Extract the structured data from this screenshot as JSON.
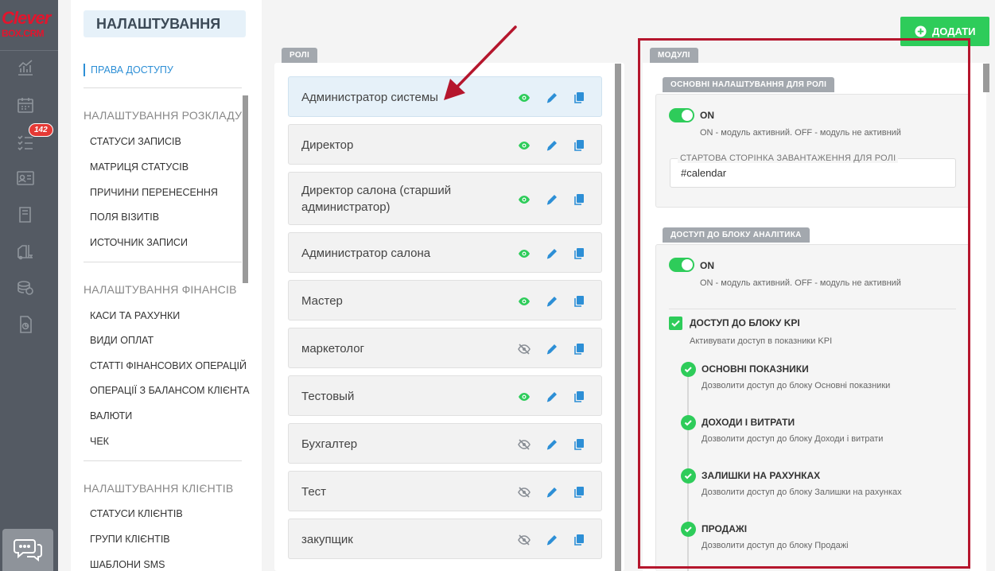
{
  "logo": {
    "line1": "Clever",
    "line2": "BOX.CRM"
  },
  "rail": {
    "badge_count": "142"
  },
  "settings": {
    "title": "НАЛАШТУВАННЯ",
    "active_item": "ПРАВА ДОСТУПУ",
    "groups": [
      {
        "heading": "НАЛАШТУВАННЯ РОЗКЛАДУ",
        "items": [
          "СТАТУСИ ЗАПИСІВ",
          "МАТРИЦЯ СТАТУСІВ",
          "ПРИЧИНИ ПЕРЕНЕСЕННЯ",
          "ПОЛЯ ВІЗИТІВ",
          "ИСТОЧНИК ЗАПИСИ"
        ]
      },
      {
        "heading": "НАЛАШТУВАННЯ ФІНАНСІВ",
        "items": [
          "КАСИ ТА РАХУНКИ",
          "ВИДИ ОПЛАТ",
          "СТАТТІ ФІНАНСОВИХ ОПЕРАЦІЙ",
          "ОПЕРАЦІЇ З БАЛАНСОМ КЛІЄНТА",
          "ВАЛЮТИ",
          "ЧЕК"
        ]
      },
      {
        "heading": "НАЛАШТУВАННЯ КЛІЄНТІВ",
        "items": [
          "СТАТУСИ КЛІЄНТІВ",
          "ГРУПИ КЛІЄНТІВ",
          "ШАБЛОНИ SMS"
        ]
      }
    ]
  },
  "roles": {
    "tab": "РОЛІ",
    "items": [
      {
        "name": "Администратор системы",
        "visible": true,
        "icon": "eye-icon"
      },
      {
        "name": "Директор",
        "visible": true,
        "icon": "eye-icon"
      },
      {
        "name": "Директор салона (старший администратор)",
        "visible": true,
        "icon": "eye-icon"
      },
      {
        "name": "Администратор салона",
        "visible": true,
        "icon": "eye-icon"
      },
      {
        "name": "Мастер",
        "visible": true,
        "icon": "eye-icon"
      },
      {
        "name": "маркетолог",
        "visible": false,
        "icon": "eye-off-icon"
      },
      {
        "name": "Тестовый",
        "visible": true,
        "icon": "eye-icon"
      },
      {
        "name": "Бухгалтер",
        "visible": false,
        "icon": "eye-off-icon"
      },
      {
        "name": "Тест",
        "visible": false,
        "icon": "eye-off-icon"
      },
      {
        "name": "закупщик",
        "visible": false,
        "icon": "eye-off-icon"
      }
    ]
  },
  "add_button": {
    "label": "ДОДАТИ"
  },
  "modules": {
    "tab": "МОДУЛІ",
    "basic": {
      "tab": "ОСНОВНІ НАЛАШТУВАННЯ ДЛЯ РОЛІ",
      "toggle_label": "ON",
      "toggle_desc": "ON - модуль активний. OFF - модуль не активний",
      "start_page_label": "СТАРТОВА СТОРІНКА ЗАВАНТАЖЕННЯ ДЛЯ РОЛІ",
      "start_page_value": "#calendar"
    },
    "analytics": {
      "tab": "ДОСТУП ДО БЛОКУ АНАЛІТИКА",
      "toggle_label": "ON",
      "toggle_desc": "ON - модуль активний. OFF - модуль не активний",
      "kpi_label": "ДОСТУП ДО БЛОКУ KPI",
      "kpi_desc": "Активувати доступ в показники KPI",
      "subitems": [
        {
          "title": "ОСНОВНІ ПОКАЗНИКИ",
          "desc": "Дозволити доступ до блоку Основні показники"
        },
        {
          "title": "ДОХОДИ І ВИТРАТИ",
          "desc": "Дозволити доступ до блоку Доходи і витрати"
        },
        {
          "title": "ЗАЛИШКИ НА РАХУНКАХ",
          "desc": "Дозволити доступ до блоку Залишки на рахунках"
        },
        {
          "title": "ПРОДАЖІ",
          "desc": "Дозволити доступ до блоку Продажі"
        }
      ]
    }
  },
  "colors": {
    "accent": "#2d8fd6",
    "green": "#2ecc5a",
    "highlight": "#b5162d",
    "rail": "#545a63"
  }
}
